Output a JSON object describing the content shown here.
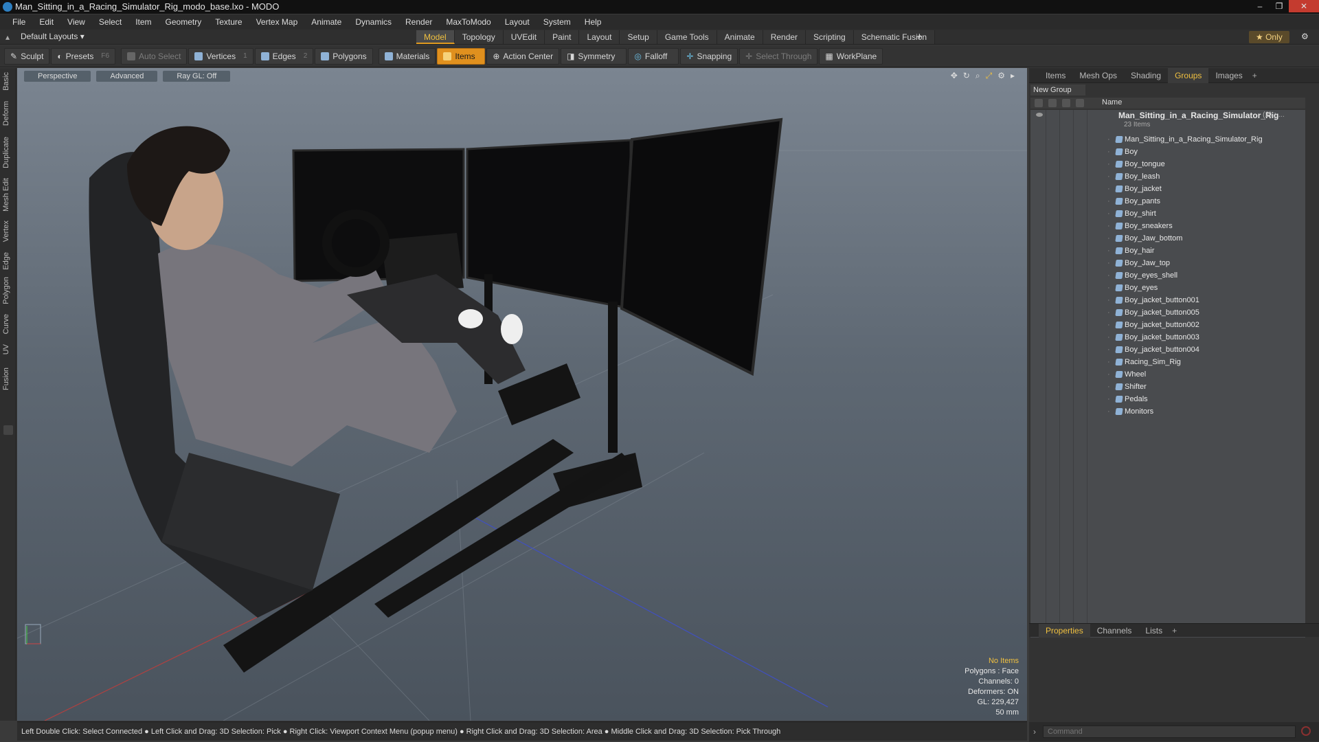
{
  "window": {
    "title": "Man_Sitting_in_a_Racing_Simulator_Rig_modo_base.lxo - MODO",
    "controls": [
      "–",
      "❐",
      "✕"
    ]
  },
  "menu": [
    "File",
    "Edit",
    "View",
    "Select",
    "Item",
    "Geometry",
    "Texture",
    "Vertex Map",
    "Animate",
    "Dynamics",
    "Render",
    "MaxToModo",
    "Layout",
    "System",
    "Help"
  ],
  "layoutbar": {
    "layout_selector": "Default Layouts ▾",
    "tabs": [
      "Model",
      "Topology",
      "UVEdit",
      "Paint",
      "Layout",
      "Setup",
      "Game Tools",
      "Animate",
      "Render",
      "Scripting",
      "Schematic Fusion"
    ],
    "active_tab": "Model",
    "add": "+",
    "only": "★ Only"
  },
  "toolbar": {
    "sculpt": "Sculpt",
    "presets": "Presets",
    "presets_key": "F6",
    "auto_select": "Auto Select",
    "vertices": "Vertices",
    "vertices_count": "1",
    "edges": "Edges",
    "edges_count": "2",
    "polygons": "Polygons",
    "materials": "Materials",
    "items": "Items",
    "action_center": "Action Center",
    "symmetry": "Symmetry",
    "falloff": "Falloff",
    "snapping": "Snapping",
    "select_through": "Select Through",
    "workplane": "WorkPlane"
  },
  "left_tabs": [
    "Basic",
    "Deform",
    "Duplicate",
    "Mesh Edit",
    "Vertex",
    "Edge",
    "Polygon",
    "Curve",
    "UV",
    "Fusion"
  ],
  "viewport": {
    "view": "Perspective",
    "shading": "Advanced",
    "raygl": "Ray GL: Off",
    "info": {
      "selection": "No Items",
      "polygons": "Polygons : Face",
      "channels": "Channels: 0",
      "deformers": "Deformers: ON",
      "gl": "GL: 229,427",
      "distance": "50 mm"
    }
  },
  "statusbar": "Left Double Click: Select Connected ● Left Click and Drag: 3D Selection: Pick ● Right Click: Viewport Context Menu (popup menu) ● Right Click and Drag: 3D Selection: Area ● Middle Click and Drag: 3D Selection: Pick Through",
  "right_panel": {
    "tabs": [
      "Items",
      "Mesh Ops",
      "Shading",
      "Groups",
      "Images"
    ],
    "active_tab": "Groups",
    "new_group": "New Group",
    "name_col": "Name",
    "group": {
      "name": "Man_Sitting_in_a_Racing_Simulator_Rig",
      "count": "(2) : ...",
      "items_label": "23 Items"
    },
    "items": [
      "Man_Sitting_in_a_Racing_Simulator_Rig",
      "Boy",
      "Boy_tongue",
      "Boy_leash",
      "Boy_jacket",
      "Boy_pants",
      "Boy_shirt",
      "Boy_sneakers",
      "Boy_Jaw_bottom",
      "Boy_hair",
      "Boy_Jaw_top",
      "Boy_eyes_shell",
      "Boy_eyes",
      "Boy_jacket_button001",
      "Boy_jacket_button005",
      "Boy_jacket_button002",
      "Boy_jacket_button003",
      "Boy_jacket_button004",
      "Racing_Sim_Rig",
      "Wheel",
      "Shifter",
      "Pedals",
      "Monitors"
    ],
    "bottom_tabs": [
      "Properties",
      "Channels",
      "Lists"
    ],
    "bottom_active": "Properties",
    "command_placeholder": "Command"
  }
}
